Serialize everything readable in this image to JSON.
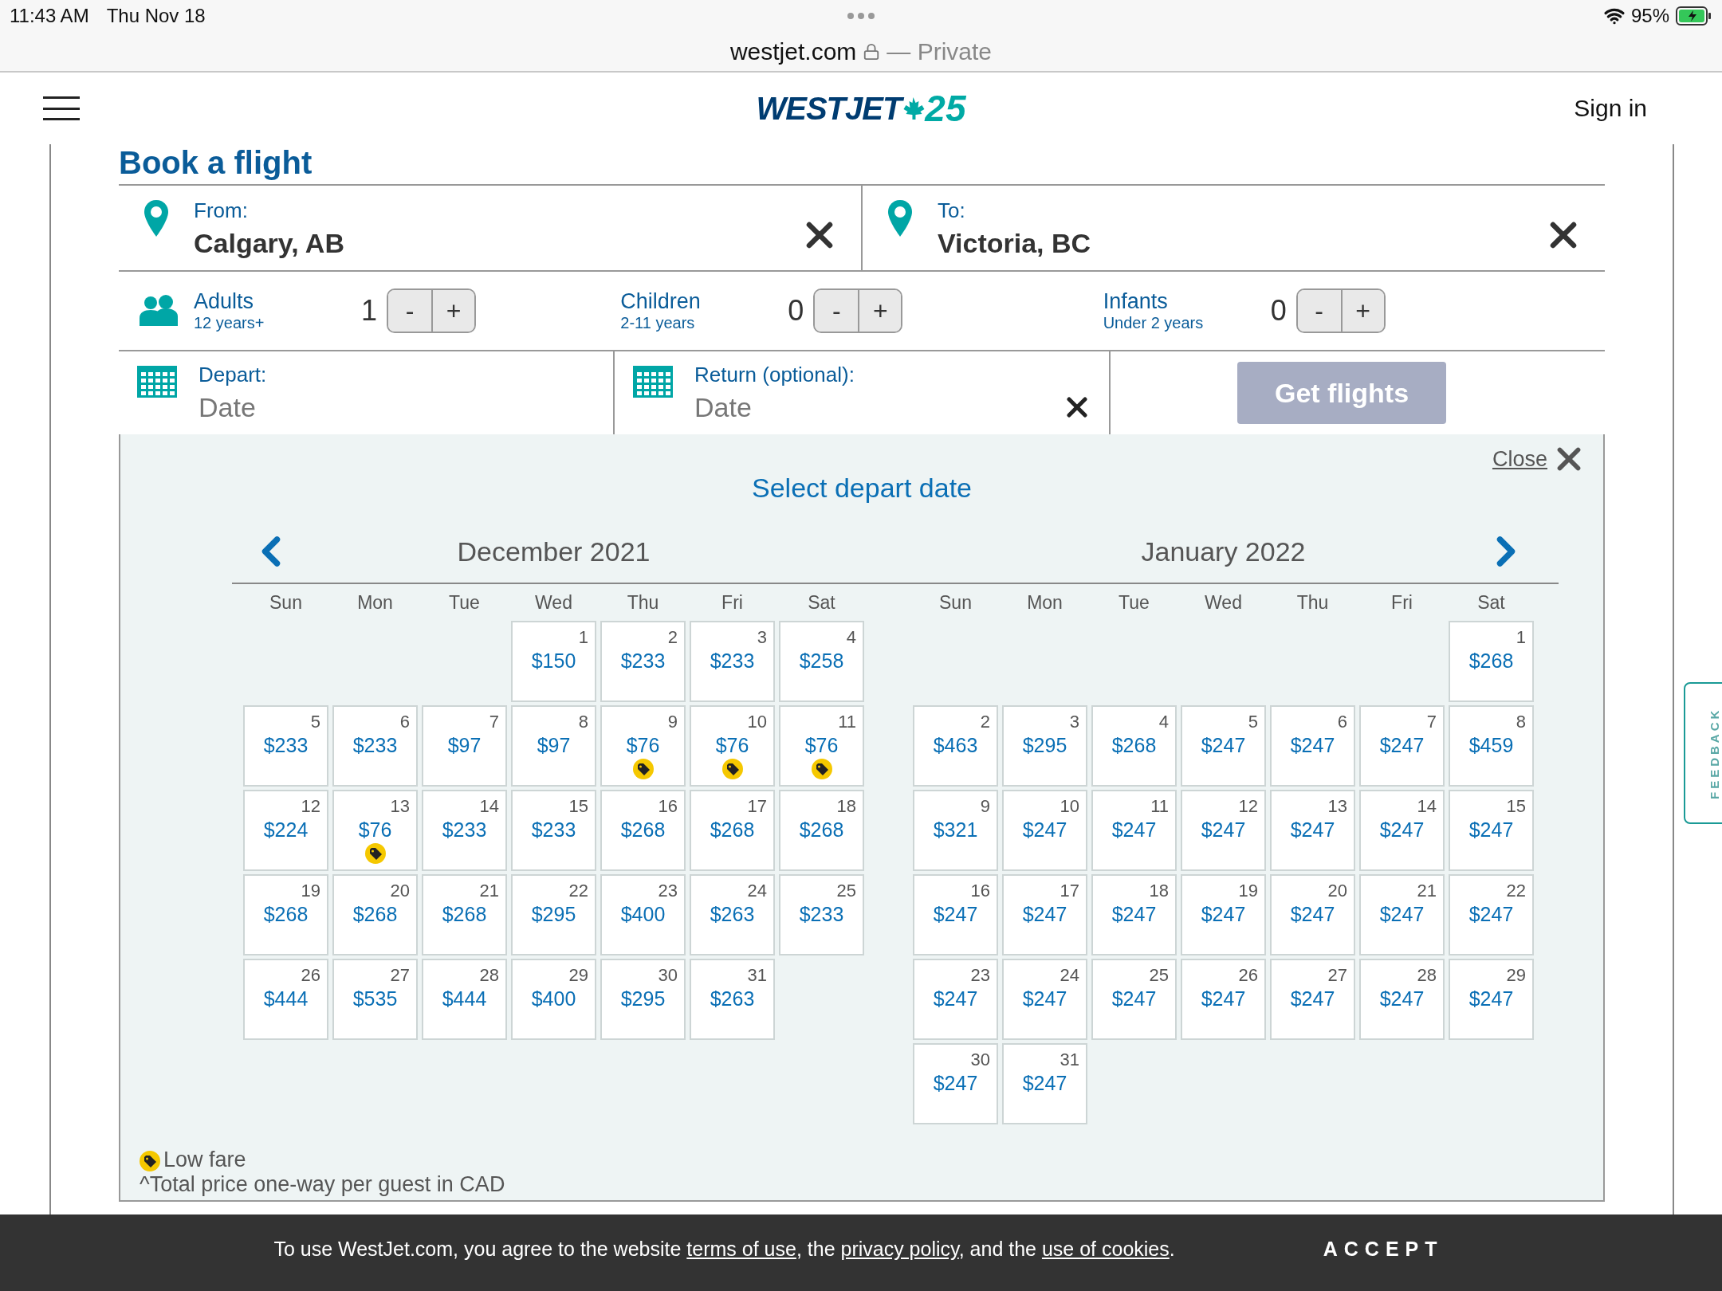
{
  "status_bar": {
    "time": "11:43 AM",
    "date": "Thu Nov 18",
    "battery": "95%"
  },
  "browser": {
    "domain": "westjet.com",
    "mode": "— Private"
  },
  "header": {
    "logo_text": "WESTJET",
    "logo_number": "25",
    "sign_in": "Sign in"
  },
  "page_title": "Book a flight",
  "route": [
    {
      "label": "From:",
      "value": "Calgary, AB"
    },
    {
      "label": "To:",
      "value": "Victoria, BC"
    }
  ],
  "passengers": [
    {
      "label": "Adults",
      "sublabel": "12 years+",
      "count": "1",
      "minus": "-",
      "plus": "+"
    },
    {
      "label": "Children",
      "sublabel": "2-11 years",
      "count": "0",
      "minus": "-",
      "plus": "+"
    },
    {
      "label": "Infants",
      "sublabel": "Under 2 years",
      "count": "0",
      "minus": "-",
      "plus": "+"
    }
  ],
  "dates": [
    {
      "label": "Depart:",
      "placeholder": "Date",
      "clearable": false
    },
    {
      "label": "Return (optional):",
      "placeholder": "Date",
      "clearable": true
    }
  ],
  "get_flights": {
    "label": "Get flights",
    "disabled": true
  },
  "calendar": {
    "close": "Close",
    "title": "Select depart date",
    "months": [
      {
        "title": "December 2021",
        "weekdays": [
          "Sun",
          "Mon",
          "Tue",
          "Wed",
          "Thu",
          "Fri",
          "Sat"
        ],
        "days": [
          {
            "kind": "blank"
          },
          {
            "kind": "blank"
          },
          {
            "kind": "blank"
          },
          {
            "kind": "day",
            "day": "1",
            "price": "$150",
            "low_fare": false
          },
          {
            "kind": "day",
            "day": "2",
            "price": "$233",
            "low_fare": false
          },
          {
            "kind": "day",
            "day": "3",
            "price": "$233",
            "low_fare": false
          },
          {
            "kind": "day",
            "day": "4",
            "price": "$258",
            "low_fare": false
          },
          {
            "kind": "day",
            "day": "5",
            "price": "$233",
            "low_fare": false
          },
          {
            "kind": "day",
            "day": "6",
            "price": "$233",
            "low_fare": false
          },
          {
            "kind": "day",
            "day": "7",
            "price": "$97",
            "low_fare": false
          },
          {
            "kind": "day",
            "day": "8",
            "price": "$97",
            "low_fare": false
          },
          {
            "kind": "day",
            "day": "9",
            "price": "$76",
            "low_fare": true
          },
          {
            "kind": "day",
            "day": "10",
            "price": "$76",
            "low_fare": true
          },
          {
            "kind": "day",
            "day": "11",
            "price": "$76",
            "low_fare": true
          },
          {
            "kind": "day",
            "day": "12",
            "price": "$224",
            "low_fare": false
          },
          {
            "kind": "day",
            "day": "13",
            "price": "$76",
            "low_fare": true
          },
          {
            "kind": "day",
            "day": "14",
            "price": "$233",
            "low_fare": false
          },
          {
            "kind": "day",
            "day": "15",
            "price": "$233",
            "low_fare": false
          },
          {
            "kind": "day",
            "day": "16",
            "price": "$268",
            "low_fare": false
          },
          {
            "kind": "day",
            "day": "17",
            "price": "$268",
            "low_fare": false
          },
          {
            "kind": "day",
            "day": "18",
            "price": "$268",
            "low_fare": false
          },
          {
            "kind": "day",
            "day": "19",
            "price": "$268",
            "low_fare": false
          },
          {
            "kind": "day",
            "day": "20",
            "price": "$268",
            "low_fare": false
          },
          {
            "kind": "day",
            "day": "21",
            "price": "$268",
            "low_fare": false
          },
          {
            "kind": "day",
            "day": "22",
            "price": "$295",
            "low_fare": false
          },
          {
            "kind": "day",
            "day": "23",
            "price": "$400",
            "low_fare": false
          },
          {
            "kind": "day",
            "day": "24",
            "price": "$263",
            "low_fare": false
          },
          {
            "kind": "day",
            "day": "25",
            "price": "$233",
            "low_fare": false
          },
          {
            "kind": "day",
            "day": "26",
            "price": "$444",
            "low_fare": false
          },
          {
            "kind": "day",
            "day": "27",
            "price": "$535",
            "low_fare": false
          },
          {
            "kind": "day",
            "day": "28",
            "price": "$444",
            "low_fare": false
          },
          {
            "kind": "day",
            "day": "29",
            "price": "$400",
            "low_fare": false
          },
          {
            "kind": "day",
            "day": "30",
            "price": "$295",
            "low_fare": false
          },
          {
            "kind": "day",
            "day": "31",
            "price": "$263",
            "low_fare": false
          }
        ]
      },
      {
        "title": "January 2022",
        "weekdays": [
          "Sun",
          "Mon",
          "Tue",
          "Wed",
          "Thu",
          "Fri",
          "Sat"
        ],
        "days": [
          {
            "kind": "blank"
          },
          {
            "kind": "blank"
          },
          {
            "kind": "blank"
          },
          {
            "kind": "blank"
          },
          {
            "kind": "blank"
          },
          {
            "kind": "blank"
          },
          {
            "kind": "day",
            "day": "1",
            "price": "$268",
            "low_fare": false
          },
          {
            "kind": "day",
            "day": "2",
            "price": "$463",
            "low_fare": false
          },
          {
            "kind": "day",
            "day": "3",
            "price": "$295",
            "low_fare": false
          },
          {
            "kind": "day",
            "day": "4",
            "price": "$268",
            "low_fare": false
          },
          {
            "kind": "day",
            "day": "5",
            "price": "$247",
            "low_fare": false
          },
          {
            "kind": "day",
            "day": "6",
            "price": "$247",
            "low_fare": false
          },
          {
            "kind": "day",
            "day": "7",
            "price": "$247",
            "low_fare": false
          },
          {
            "kind": "day",
            "day": "8",
            "price": "$459",
            "low_fare": false
          },
          {
            "kind": "day",
            "day": "9",
            "price": "$321",
            "low_fare": false
          },
          {
            "kind": "day",
            "day": "10",
            "price": "$247",
            "low_fare": false
          },
          {
            "kind": "day",
            "day": "11",
            "price": "$247",
            "low_fare": false
          },
          {
            "kind": "day",
            "day": "12",
            "price": "$247",
            "low_fare": false
          },
          {
            "kind": "day",
            "day": "13",
            "price": "$247",
            "low_fare": false
          },
          {
            "kind": "day",
            "day": "14",
            "price": "$247",
            "low_fare": false
          },
          {
            "kind": "day",
            "day": "15",
            "price": "$247",
            "low_fare": false
          },
          {
            "kind": "day",
            "day": "16",
            "price": "$247",
            "low_fare": false
          },
          {
            "kind": "day",
            "day": "17",
            "price": "$247",
            "low_fare": false
          },
          {
            "kind": "day",
            "day": "18",
            "price": "$247",
            "low_fare": false
          },
          {
            "kind": "day",
            "day": "19",
            "price": "$247",
            "low_fare": false
          },
          {
            "kind": "day",
            "day": "20",
            "price": "$247",
            "low_fare": false
          },
          {
            "kind": "day",
            "day": "21",
            "price": "$247",
            "low_fare": false
          },
          {
            "kind": "day",
            "day": "22",
            "price": "$247",
            "low_fare": false
          },
          {
            "kind": "day",
            "day": "23",
            "price": "$247",
            "low_fare": false
          },
          {
            "kind": "day",
            "day": "24",
            "price": "$247",
            "low_fare": false
          },
          {
            "kind": "day",
            "day": "25",
            "price": "$247",
            "low_fare": false
          },
          {
            "kind": "day",
            "day": "26",
            "price": "$247",
            "low_fare": false
          },
          {
            "kind": "day",
            "day": "27",
            "price": "$247",
            "low_fare": false
          },
          {
            "kind": "day",
            "day": "28",
            "price": "$247",
            "low_fare": false
          },
          {
            "kind": "day",
            "day": "29",
            "price": "$247",
            "low_fare": false
          },
          {
            "kind": "day",
            "day": "30",
            "price": "$247",
            "low_fare": false
          },
          {
            "kind": "day",
            "day": "31",
            "price": "$247",
            "low_fare": false
          }
        ]
      }
    ]
  },
  "legend": {
    "low_fare": "Low fare",
    "note": "^Total price one-way per guest in CAD"
  },
  "cookie_notice": {
    "parts": [
      {
        "kind": "text",
        "text": "To use WestJet.com, you agree to the website "
      },
      {
        "kind": "link",
        "text": "terms of use"
      },
      {
        "kind": "text",
        "text": ", the "
      },
      {
        "kind": "link",
        "text": "privacy policy"
      },
      {
        "kind": "text",
        "text": ", and the "
      },
      {
        "kind": "link",
        "text": "use of cookies"
      },
      {
        "kind": "text",
        "text": "."
      }
    ],
    "accept": "ACCEPT"
  },
  "feedback": "FEEDBACK"
}
